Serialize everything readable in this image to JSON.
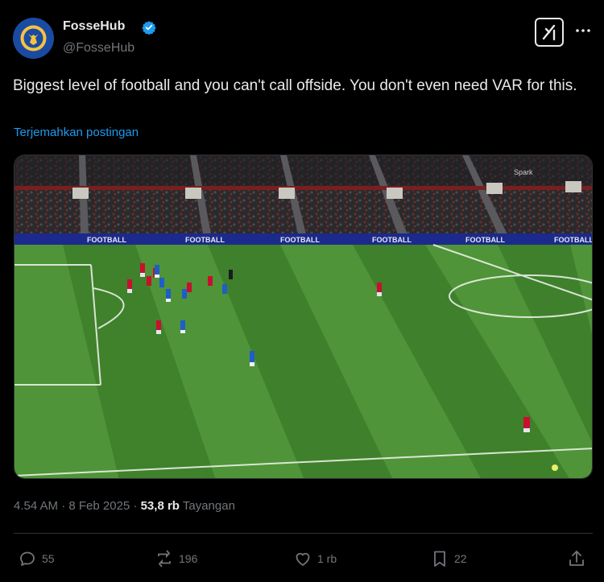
{
  "author": {
    "name": "FosseHub",
    "handle": "@FosseHub",
    "verified": true,
    "avatar_icon": "leicester-fox-crest-icon"
  },
  "header_icons": [
    "grok-icon",
    "more-options-icon"
  ],
  "tweet": {
    "text": "Biggest level of football and you can't call offside. You don't even need VAR for this.",
    "translate_label": "Terjemahkan postingan",
    "media": {
      "type": "image",
      "board_text": "FOOTBALL",
      "watermark": "Spark"
    },
    "timestamp": "4.54 AM · 8 Feb 2025 · ",
    "views_count": "53,8 rb",
    "views_label": " Tayangan"
  },
  "actions": {
    "reply": {
      "icon": "reply-icon",
      "count": "55"
    },
    "repost": {
      "icon": "repost-icon",
      "count": "196"
    },
    "like": {
      "icon": "heart-icon",
      "count": "1 rb"
    },
    "bookmark": {
      "icon": "bookmark-icon",
      "count": "22"
    },
    "share": {
      "icon": "share-icon"
    }
  },
  "colors": {
    "background": "#000000",
    "text": "#e7e9ea",
    "secondary": "#71767b",
    "link": "#1d9bf0",
    "pitch_light": "#4f9438",
    "pitch_dark": "#3e7e2b"
  }
}
